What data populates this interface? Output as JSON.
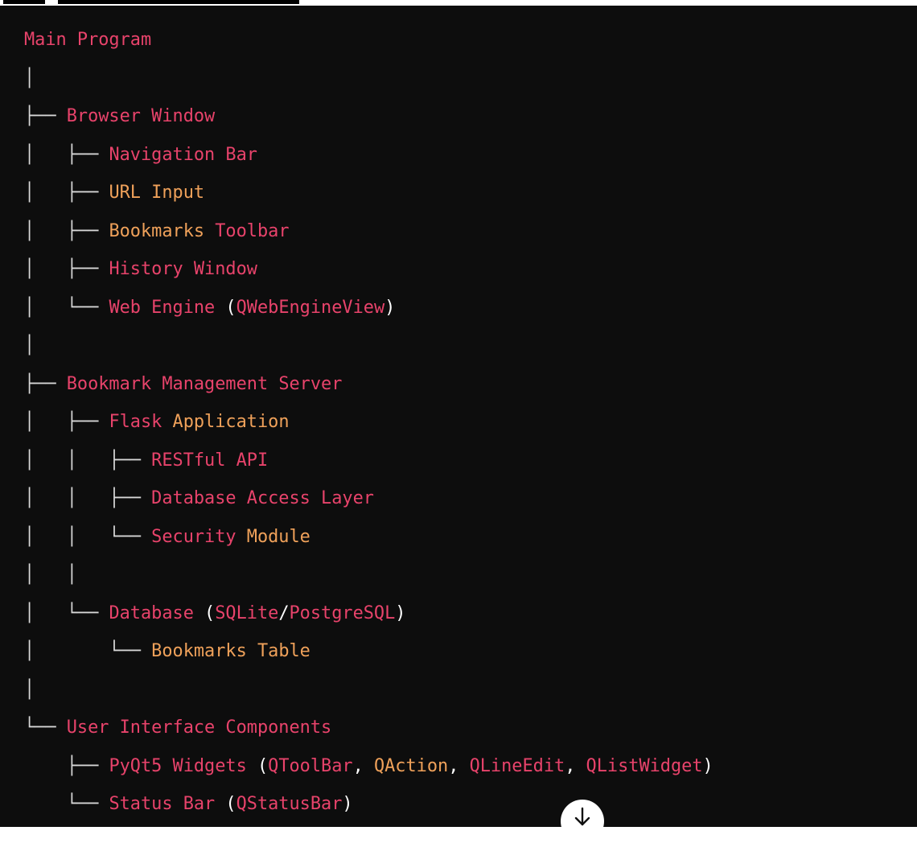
{
  "tree": {
    "lines": [
      {
        "prefix": "",
        "tokens": [
          {
            "t": "Main",
            "c": "r"
          },
          {
            "t": " Program",
            "c": "r"
          }
        ]
      },
      {
        "prefix": "│",
        "tokens": []
      },
      {
        "prefix": "├── ",
        "tokens": [
          {
            "t": "Browser",
            "c": "r"
          },
          {
            "t": " Window",
            "c": "r"
          }
        ]
      },
      {
        "prefix": "│   ├── ",
        "tokens": [
          {
            "t": "Navigation",
            "c": "r"
          },
          {
            "t": " Bar",
            "c": "r"
          }
        ]
      },
      {
        "prefix": "│   ├── ",
        "tokens": [
          {
            "t": "URL",
            "c": "o"
          },
          {
            "t": " Input",
            "c": "o"
          }
        ]
      },
      {
        "prefix": "│   ├── ",
        "tokens": [
          {
            "t": "Bookmarks",
            "c": "o"
          },
          {
            "t": " Toolbar",
            "c": "r"
          }
        ]
      },
      {
        "prefix": "│   ├── ",
        "tokens": [
          {
            "t": "History",
            "c": "r"
          },
          {
            "t": " Window",
            "c": "r"
          }
        ]
      },
      {
        "prefix": "│   └── ",
        "tokens": [
          {
            "t": "Web",
            "c": "r"
          },
          {
            "t": " Engine",
            "c": "r"
          },
          {
            "t": " (",
            "c": "p"
          },
          {
            "t": "QWebEngineView",
            "c": "r"
          },
          {
            "t": ")",
            "c": "p"
          }
        ]
      },
      {
        "prefix": "│",
        "tokens": []
      },
      {
        "prefix": "├── ",
        "tokens": [
          {
            "t": "Bookmark",
            "c": "r"
          },
          {
            "t": " Management",
            "c": "r"
          },
          {
            "t": " Server",
            "c": "r"
          }
        ]
      },
      {
        "prefix": "│   ├── ",
        "tokens": [
          {
            "t": "Flask",
            "c": "r"
          },
          {
            "t": " Application",
            "c": "o"
          }
        ]
      },
      {
        "prefix": "│   │   ├── ",
        "tokens": [
          {
            "t": "RESTful",
            "c": "r"
          },
          {
            "t": " API",
            "c": "r"
          }
        ]
      },
      {
        "prefix": "│   │   ├── ",
        "tokens": [
          {
            "t": "Database",
            "c": "r"
          },
          {
            "t": " Access",
            "c": "r"
          },
          {
            "t": " Layer",
            "c": "r"
          }
        ]
      },
      {
        "prefix": "│   │   └── ",
        "tokens": [
          {
            "t": "Security",
            "c": "r"
          },
          {
            "t": " Module",
            "c": "o"
          }
        ]
      },
      {
        "prefix": "│   │",
        "tokens": []
      },
      {
        "prefix": "│   └── ",
        "tokens": [
          {
            "t": "Database",
            "c": "r"
          },
          {
            "t": " (",
            "c": "p"
          },
          {
            "t": "SQLite",
            "c": "r"
          },
          {
            "t": "/",
            "c": "p"
          },
          {
            "t": "PostgreSQL",
            "c": "r"
          },
          {
            "t": ")",
            "c": "p"
          }
        ]
      },
      {
        "prefix": "│       └── ",
        "tokens": [
          {
            "t": "Bookmarks",
            "c": "o"
          },
          {
            "t": " Table",
            "c": "o"
          }
        ]
      },
      {
        "prefix": "│",
        "tokens": []
      },
      {
        "prefix": "└── ",
        "tokens": [
          {
            "t": "User",
            "c": "r"
          },
          {
            "t": " Interface",
            "c": "r"
          },
          {
            "t": " Components",
            "c": "r"
          }
        ]
      },
      {
        "prefix": "    ├── ",
        "tokens": [
          {
            "t": "PyQt5",
            "c": "r"
          },
          {
            "t": " Widgets",
            "c": "r"
          },
          {
            "t": " (",
            "c": "p"
          },
          {
            "t": "QToolBar",
            "c": "r"
          },
          {
            "t": ",",
            "c": "p"
          },
          {
            "t": " QAction",
            "c": "o"
          },
          {
            "t": ",",
            "c": "p"
          },
          {
            "t": " QLineEdit",
            "c": "r"
          },
          {
            "t": ",",
            "c": "p"
          },
          {
            "t": " QListWidget",
            "c": "r"
          },
          {
            "t": ")",
            "c": "p"
          }
        ]
      },
      {
        "prefix": "    └── ",
        "tokens": [
          {
            "t": "Status",
            "c": "r"
          },
          {
            "t": " Bar",
            "c": "r"
          },
          {
            "t": " (",
            "c": "p"
          },
          {
            "t": "QStatusBar",
            "c": "r"
          },
          {
            "t": ")",
            "c": "p"
          }
        ]
      }
    ]
  },
  "scroll_button": {
    "icon": "arrow-down-icon"
  }
}
